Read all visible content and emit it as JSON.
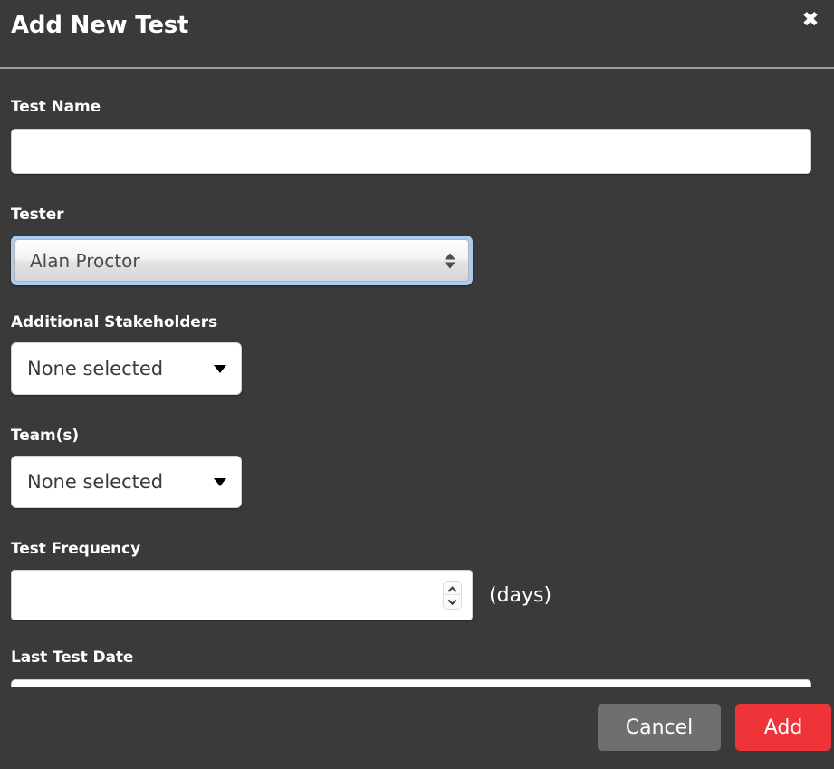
{
  "dialog": {
    "title": "Add New Test",
    "close_icon": "close-icon"
  },
  "fields": {
    "test_name": {
      "label": "Test Name",
      "value": "",
      "placeholder": ""
    },
    "tester": {
      "label": "Tester",
      "selected": "Alan Proctor",
      "arrows_icon": "updown-triangles-icon"
    },
    "additional_stakeholders": {
      "label": "Additional Stakeholders",
      "selected": "None selected",
      "caret_icon": "caret-down-icon"
    },
    "teams": {
      "label": "Team(s)",
      "selected": "None selected",
      "caret_icon": "caret-down-icon"
    },
    "test_frequency": {
      "label": "Test Frequency",
      "value": "",
      "placeholder": "",
      "units": "(days)",
      "spinner_up_icon": "chevron-up-icon",
      "spinner_down_icon": "chevron-down-icon"
    },
    "last_test_date": {
      "label": "Last Test Date",
      "value": "",
      "placeholder": ""
    }
  },
  "footer": {
    "cancel_label": "Cancel",
    "add_label": "Add"
  },
  "colors": {
    "background": "#3b3a3a",
    "accent_red": "#ee3339",
    "cancel_gray": "#6f6f6f",
    "focus_ring": "#a9cdf0"
  }
}
